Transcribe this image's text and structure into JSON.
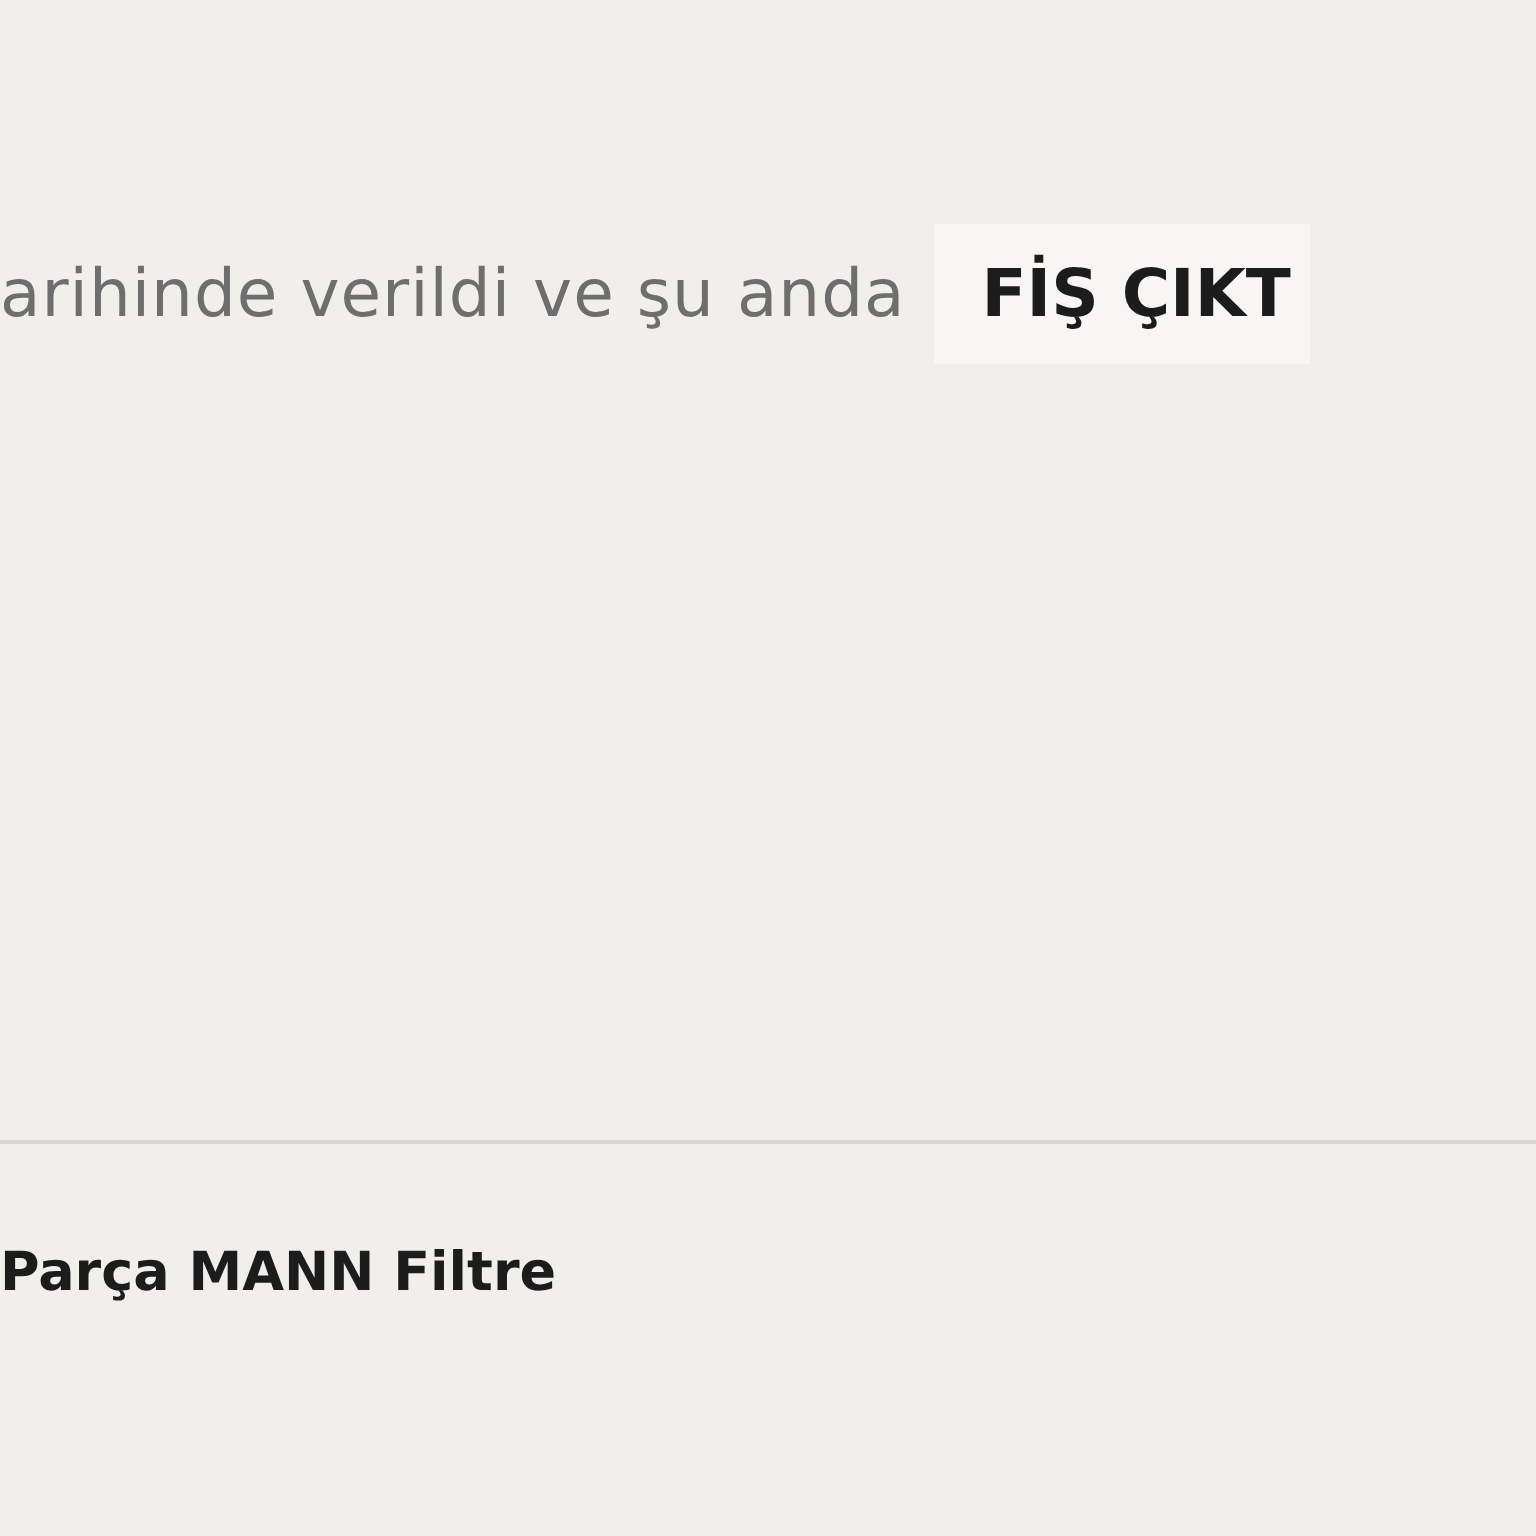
{
  "status_line": {
    "text": "arihinde verildi ve şu anda",
    "badge": "FİŞ ÇIKT"
  },
  "item": {
    "title": "Parça MANN Filtre"
  }
}
